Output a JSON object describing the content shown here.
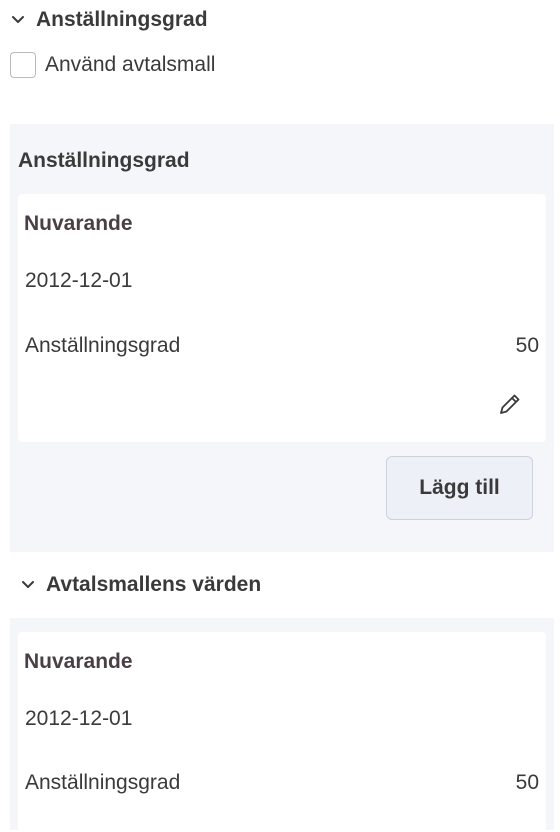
{
  "section": {
    "title": "Anställningsgrad"
  },
  "checkbox": {
    "label": "Använd avtalsmall",
    "checked": false
  },
  "panel": {
    "title": "Anställningsgrad",
    "card": {
      "heading": "Nuvarande",
      "date": "2012-12-01",
      "field_label": "Anställningsgrad",
      "field_value": "50"
    },
    "add_button_label": "Lägg till"
  },
  "template_section": {
    "title": "Avtalsmallens värden",
    "card": {
      "heading": "Nuvarande",
      "date": "2012-12-01",
      "field_label": "Anställningsgrad",
      "field_value": "50"
    }
  },
  "icons": {
    "section_toggle": "chevron-down-icon",
    "edit": "pencil-icon"
  }
}
